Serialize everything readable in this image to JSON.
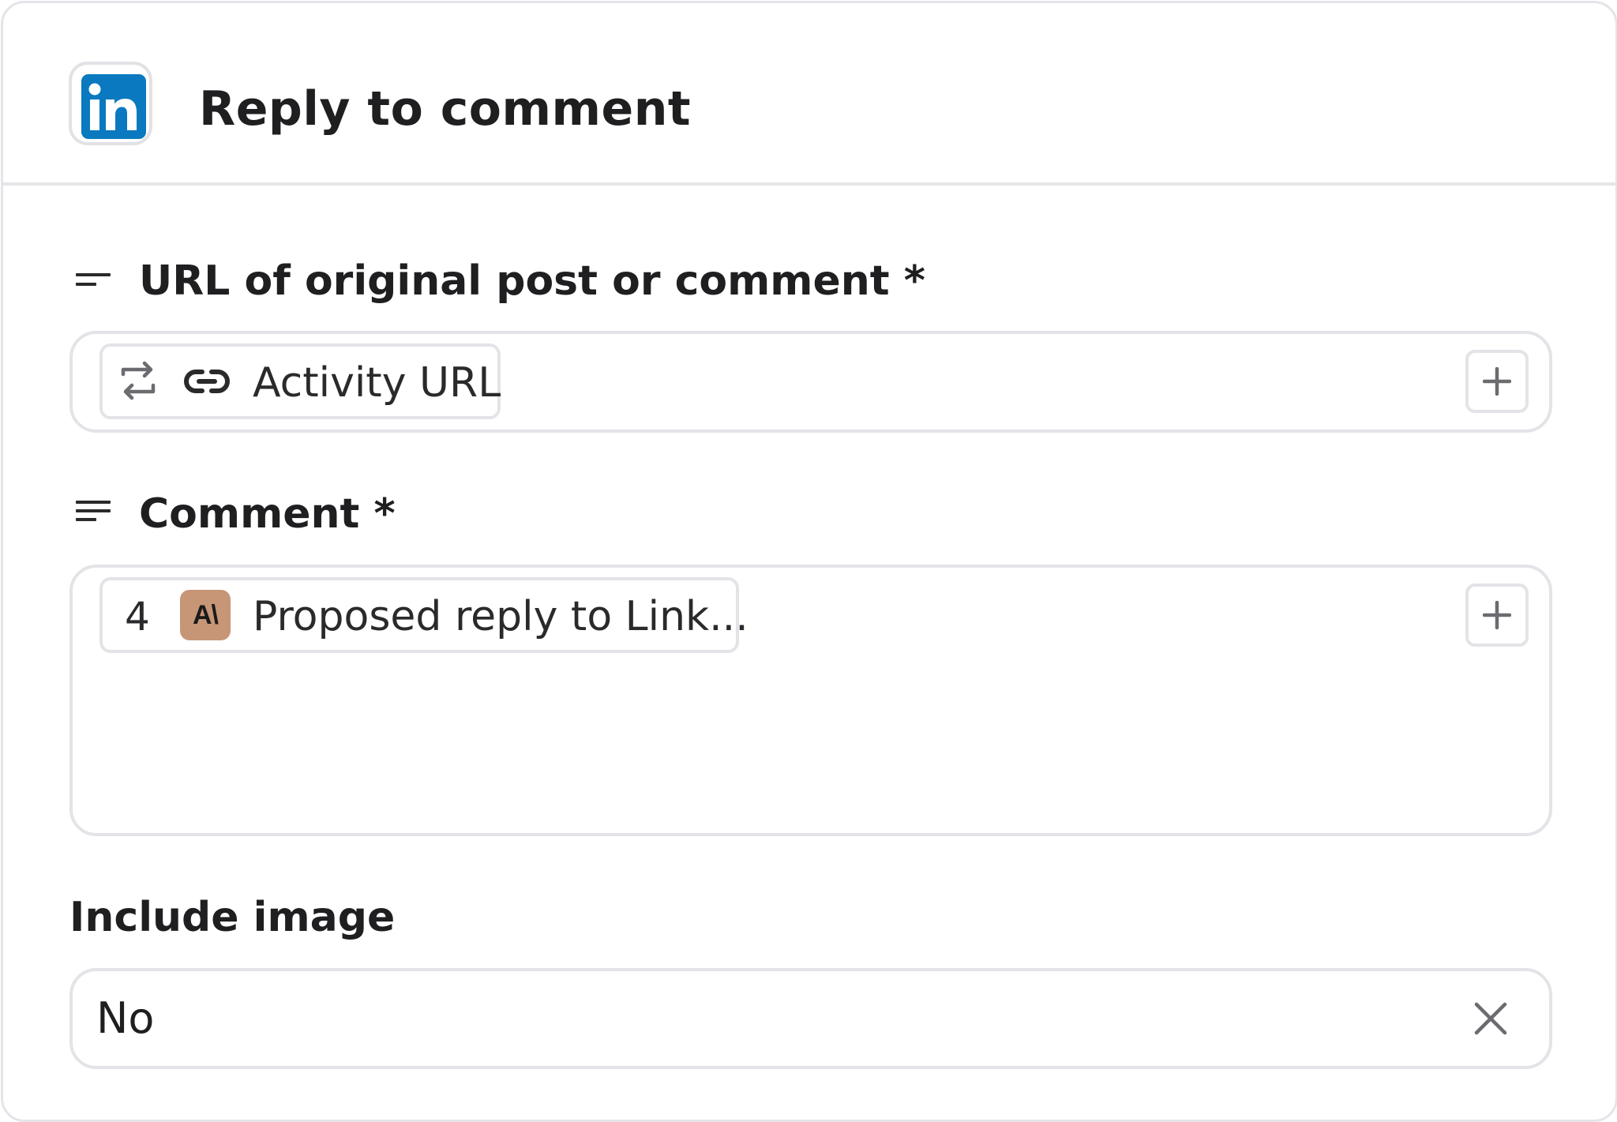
{
  "header": {
    "app_icon": "linkedin-logo",
    "title": "Reply to comment"
  },
  "fields": {
    "url": {
      "label": "URL of original post or comment *",
      "label_icon": "short-text-icon",
      "pill": {
        "icons": [
          "repeat-icon",
          "link-icon"
        ],
        "text": "Activity URL"
      },
      "add_icon": "plus-icon"
    },
    "comment": {
      "label": "Comment *",
      "label_icon": "long-text-icon",
      "pill": {
        "step_number": "4",
        "badge_icon": "anthropic-logo",
        "badge_text": "A\\",
        "text": "Proposed reply to Link..."
      },
      "add_icon": "plus-icon"
    },
    "include_image": {
      "label": "Include image",
      "value": "No",
      "clear_icon": "close-icon"
    }
  },
  "colors": {
    "linkedin_blue": "#0a79c0",
    "badge_tan": "#c79677",
    "border_gray": "#e3e3e8",
    "text_dark": "#1f1f21",
    "icon_gray": "#6b6b70"
  }
}
